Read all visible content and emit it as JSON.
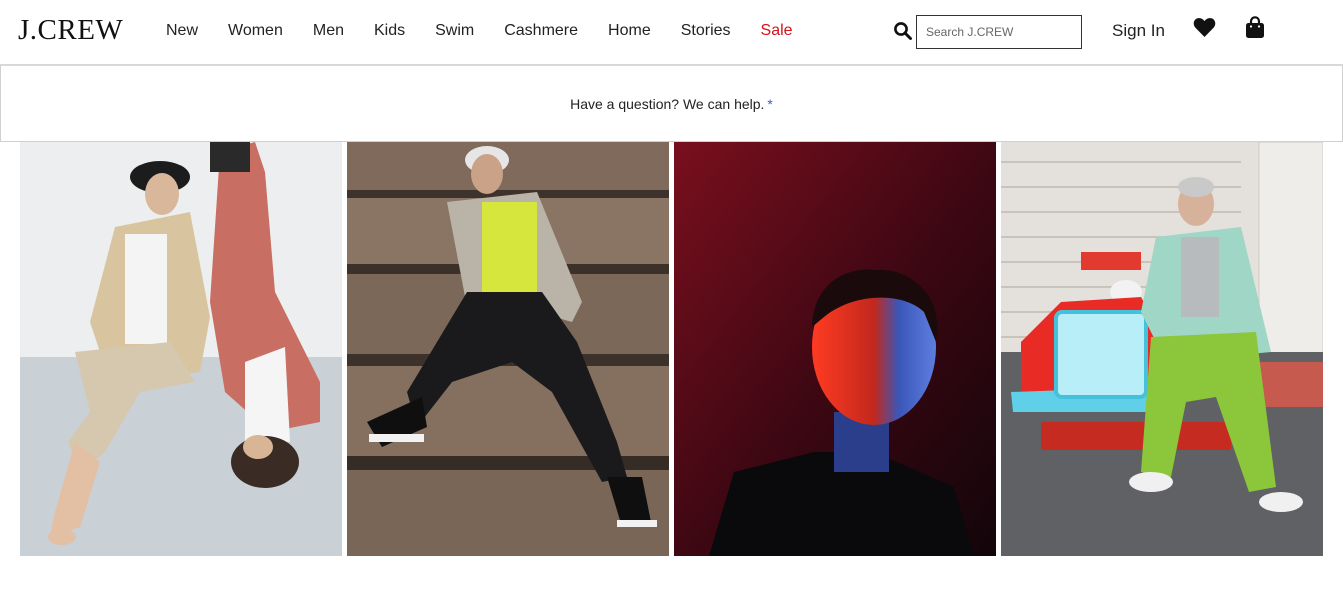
{
  "header": {
    "logo": "J.CREW",
    "nav": [
      {
        "label": "New"
      },
      {
        "label": "Women"
      },
      {
        "label": "Men"
      },
      {
        "label": "Kids"
      },
      {
        "label": "Swim"
      },
      {
        "label": "Cashmere"
      },
      {
        "label": "Home"
      },
      {
        "label": "Stories"
      },
      {
        "label": "Sale",
        "color": "#d6111a"
      }
    ],
    "search": {
      "placeholder": "Search J.CREW",
      "value": ""
    },
    "sign_in": "Sign In",
    "icons": {
      "search": "search-icon",
      "wishlist": "heart-icon",
      "bag": "shopping-bag-icon"
    }
  },
  "help": {
    "text": "Have a question? We can help.",
    "star": "*",
    "star_color": "#3a57c4"
  },
  "photos": [
    {
      "name": "photo-two-models-floor"
    },
    {
      "name": "photo-model-stone-steps"
    },
    {
      "name": "photo-model-red-blue-light"
    },
    {
      "name": "photo-model-toy-car"
    }
  ]
}
